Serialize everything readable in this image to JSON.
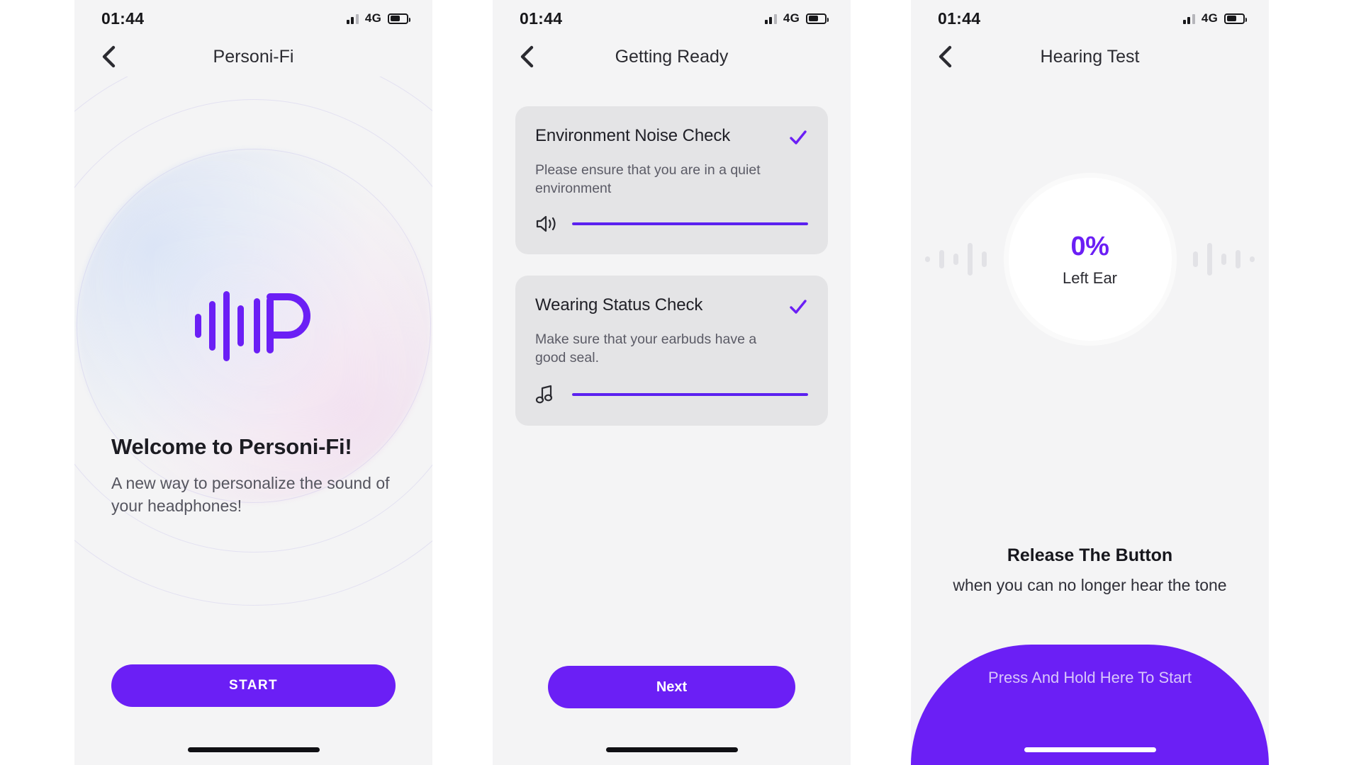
{
  "status_bar": {
    "time": "01:44",
    "network": "4G",
    "signal_icon": "signal-bars-icon",
    "battery_icon": "battery-icon"
  },
  "colors": {
    "accent": "#6B1FF5",
    "progress": "#5B21F0",
    "screen_bg": "#F4F4F5",
    "card_bg": "#E4E4E6",
    "muted_text": "#5B5B66"
  },
  "screen1": {
    "nav_title": "Personi-Fi",
    "back_icon": "chevron-left-icon",
    "logo_icon": "personifi-logo-icon",
    "heading": "Welcome to Personi-Fi!",
    "subheading": "A new way to personalize the sound of your headphones!",
    "start_button": "START"
  },
  "screen2": {
    "nav_title": "Getting Ready",
    "back_icon": "chevron-left-icon",
    "cards": [
      {
        "title": "Environment Noise Check",
        "subtitle": "Please ensure that you are in a quiet environment",
        "icon": "speaker-wave-icon",
        "status_icon": "check-icon",
        "progress_percent": 100
      },
      {
        "title": "Wearing Status Check",
        "subtitle": "Make sure that your earbuds have a good seal.",
        "icon": "music-note-icon",
        "status_icon": "check-icon",
        "progress_percent": 100
      }
    ],
    "next_button": "Next"
  },
  "screen3": {
    "nav_title": "Hearing Test",
    "back_icon": "chevron-left-icon",
    "progress_value": "0%",
    "ear_label": "Left Ear",
    "equalizer_icon": "audio-waveform-icon",
    "instruction_title": "Release The Button",
    "instruction_text": "when you can no longer hear the tone",
    "hold_button_label": "Press And Hold Here To Start"
  }
}
